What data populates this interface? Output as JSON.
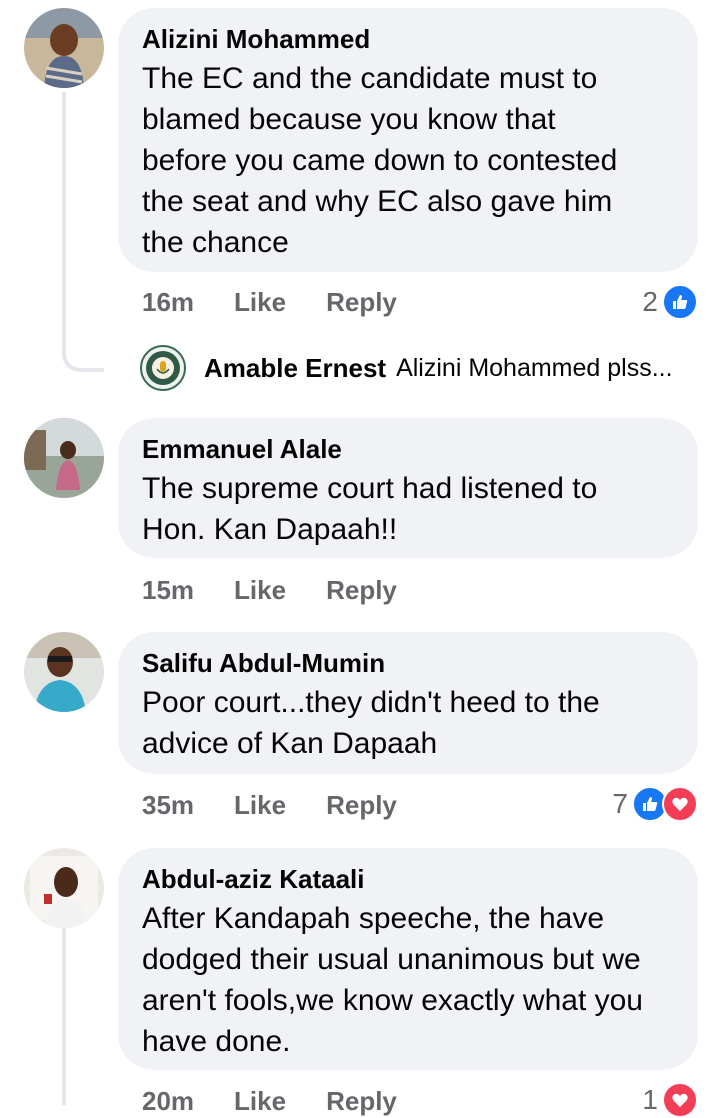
{
  "comments": [
    {
      "name": "Alizini Mohammed",
      "lines": [
        "The EC and the candidate must to",
        "blamed because you know that",
        "before you came down to contested",
        "the seat and why EC also gave him",
        "the chance"
      ],
      "time": "16m",
      "like": "Like",
      "reply": "Reply",
      "reaction_count": "2",
      "reactions": [
        "like"
      ]
    },
    {
      "name": "Emmanuel Alale",
      "lines": [
        "The supreme court had listened to",
        "Hon. Kan Dapaah!!"
      ],
      "time": "15m",
      "like": "Like",
      "reply": "Reply"
    },
    {
      "name": "Salifu Abdul-Mumin",
      "lines": [
        "Poor court...they didn't heed to the",
        "advice of Kan Dapaah"
      ],
      "time": "35m",
      "like": "Like",
      "reply": "Reply",
      "reaction_count": "7",
      "reactions": [
        "like",
        "love"
      ]
    },
    {
      "name": "Abdul-aziz Kataali",
      "lines": [
        "After Kandapah speeche, the have",
        "dodged their usual unanimous but we",
        "aren't fools,we know exactly what you",
        "have done."
      ],
      "time": "20m",
      "like": "Like",
      "reply": "Reply",
      "reaction_count": "1",
      "reactions": [
        "love"
      ]
    }
  ],
  "reply_preview": {
    "name": "Amable Ernest",
    "text": "Alizini Mohammed plss..."
  },
  "colors": {
    "bubble": "#f0f2f5",
    "meta": "#65676b",
    "like_blue": "#1877f2",
    "love_red": "#f33e58"
  }
}
